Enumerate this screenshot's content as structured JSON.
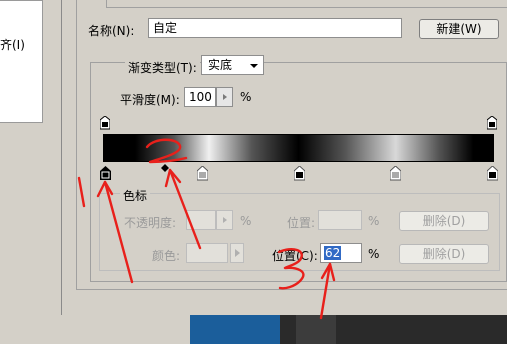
{
  "left": {
    "label": "齐(I)"
  },
  "name_row": {
    "label": "名称(N):",
    "value": "自定",
    "new_button": "新建(W)"
  },
  "gradient_type": {
    "label": "渐变类型(T):",
    "selected": "实底"
  },
  "smoothness": {
    "label": "平滑度(M):",
    "value": "100",
    "unit": "%"
  },
  "color_stops": {
    "group_title": "色标",
    "opacity_label": "不透明度:",
    "opacity_unit": "%",
    "location_label_top": "位置:",
    "location_unit_top": "%",
    "delete_top": "删除(D)",
    "color_label": "颜色:",
    "location_label": "位置(C):",
    "location_value": "62",
    "location_unit": "%",
    "delete_bottom": "删除(D)"
  },
  "annotations": [
    "1",
    "2",
    "3"
  ],
  "colors": {
    "annotation_red": "#e8201b",
    "selection_blue": "#316ac5",
    "taskbar_blue": "#1b5e9b"
  },
  "icons": [
    "dropdown-arrow-icon",
    "stepper-arrow-icon",
    "color-stop-icon",
    "opacity-stop-icon",
    "midpoint-diamond-icon"
  ]
}
